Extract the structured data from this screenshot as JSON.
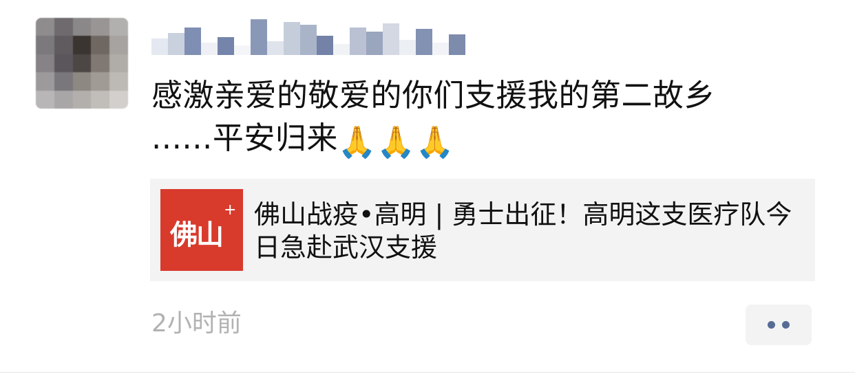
{
  "post": {
    "author_name": "",
    "text_line1": "感激亲爱的敬爱的你们支援我的第二故乡",
    "text_line2": "......平安归来",
    "emoji": "🙏🙏🙏"
  },
  "link_card": {
    "thumbnail_text": "佛山",
    "thumbnail_plus": "+",
    "title": "佛山战疫•高明 | 勇士出征！高明这支医疗队今日急赴武汉支援",
    "thumbnail_color": "#d83a2c"
  },
  "footer": {
    "timestamp": "2小时前",
    "more_icon": "ellipsis-icon",
    "accent_color": "#576b95"
  }
}
